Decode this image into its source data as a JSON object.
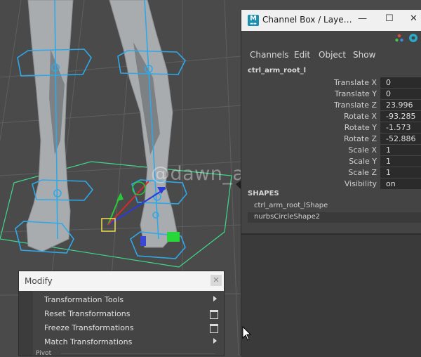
{
  "watermark": "@dawn_arc",
  "channel_box": {
    "title": "Channel Box / Laye…",
    "menu": [
      "Channels",
      "Edit",
      "Object",
      "Show"
    ],
    "node_name": "ctrl_arm_root_l",
    "attributes": [
      {
        "label": "Translate X",
        "value": "0"
      },
      {
        "label": "Translate Y",
        "value": "0"
      },
      {
        "label": "Translate Z",
        "value": "23.996"
      },
      {
        "label": "Rotate X",
        "value": "-93.285"
      },
      {
        "label": "Rotate Y",
        "value": "-1.573"
      },
      {
        "label": "Rotate Z",
        "value": "-52.886"
      },
      {
        "label": "Scale X",
        "value": "1"
      },
      {
        "label": "Scale Y",
        "value": "1"
      },
      {
        "label": "Scale Z",
        "value": "1"
      },
      {
        "label": "Visibility",
        "value": "on"
      }
    ],
    "shapes_header": "SHAPES",
    "shapes": [
      "ctrl_arm_root_lShape",
      "nurbsCircleShape2"
    ]
  },
  "modify_menu": {
    "title": "Modify",
    "items": [
      {
        "label": "Transformation Tools",
        "kind": "submenu"
      },
      {
        "label": "Reset Transformations",
        "kind": "option-box"
      },
      {
        "label": "Freeze Transformations",
        "kind": "option-box"
      },
      {
        "label": "Match Transformations",
        "kind": "submenu"
      }
    ],
    "section": "Pivot"
  },
  "colors": {
    "viewport_bg": "#4a4a4a",
    "grid": "#5f5f5f",
    "controller": "#2ea8e8",
    "selection": "#3fd88a",
    "panel_bg": "#444444",
    "field_bg": "#2b2b2b",
    "maya_logo": "#1b8fb0"
  },
  "icons": [
    "maya-logo-icon",
    "minimize-icon",
    "maximize-icon",
    "close-icon",
    "channel-box-tool-icon",
    "help-icon",
    "submenu-arrow-icon",
    "option-box-icon",
    "mouse-cursor-icon"
  ]
}
